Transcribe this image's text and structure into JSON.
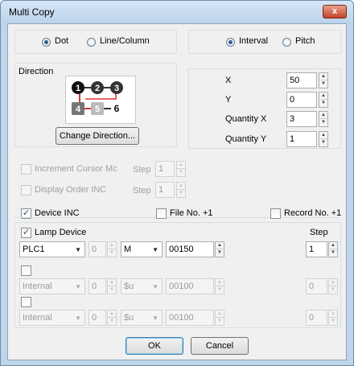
{
  "window": {
    "title": "Multi Copy",
    "close_glyph": "x"
  },
  "mode": {
    "dot_label": "Dot",
    "line_column_label": "Line/Column",
    "selected": "dot"
  },
  "spacing": {
    "interval_label": "Interval",
    "pitch_label": "Pitch",
    "selected": "interval"
  },
  "direction": {
    "group_label": "Direction",
    "change_button": "Change Direction...",
    "nodes": [
      "1",
      "2",
      "3",
      "4",
      "5",
      "6"
    ]
  },
  "params": {
    "x_label": "X",
    "x_value": "50",
    "y_label": "Y",
    "y_value": "0",
    "qx_label": "Quantity X",
    "qx_value": "3",
    "qy_label": "Quantity Y",
    "qy_value": "1"
  },
  "increment_cursor": {
    "label": "Increment Cursor Mc",
    "step_label": "Step",
    "step_value": "1",
    "checked": false
  },
  "display_order": {
    "label": "Display Order INC",
    "step_label": "Step",
    "step_value": "1",
    "checked": false
  },
  "device_inc": {
    "label": "Device INC",
    "checked": true
  },
  "file_no": {
    "label": "File No. +1",
    "checked": false
  },
  "record_no": {
    "label": "Record No. +1",
    "checked": false
  },
  "lamp": {
    "label": "Lamp Device",
    "checked": true,
    "step_header": "Step",
    "rows": [
      {
        "enabled": true,
        "checked": true,
        "plc": "PLC1",
        "num": "0",
        "device": "M",
        "address": "00150",
        "step": "1"
      },
      {
        "enabled": false,
        "checked": false,
        "plc": "Internal",
        "num": "0",
        "device": "$u",
        "address": "00100",
        "step": "0"
      },
      {
        "enabled": false,
        "checked": false,
        "plc": "Internal",
        "num": "0",
        "device": "$u",
        "address": "00100",
        "step": "0"
      }
    ]
  },
  "buttons": {
    "ok": "OK",
    "cancel": "Cancel"
  },
  "colors": {
    "accent": "#3c7fb1",
    "title_bar": "#bfd5ea",
    "close": "#c4432b"
  }
}
